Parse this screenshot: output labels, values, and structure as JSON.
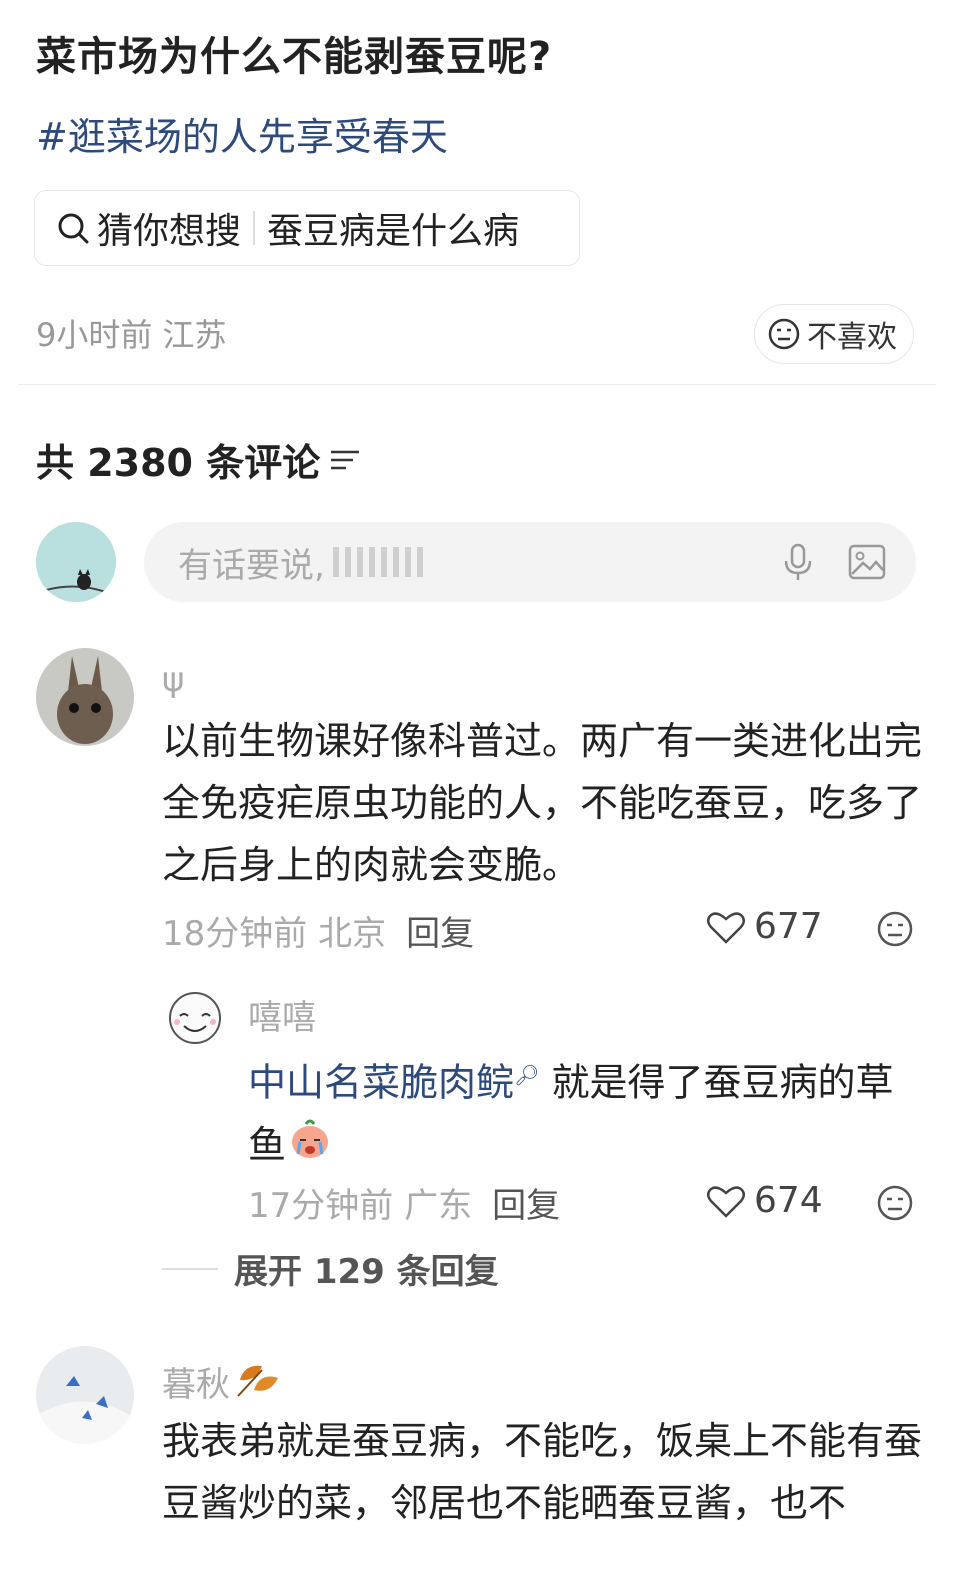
{
  "post": {
    "title": "菜市场为什么不能剥蚕豆呢?",
    "topic": "#逛菜场的人先享受春天",
    "search_suggest": {
      "lead": "猜你想搜",
      "query": "蚕豆病是什么病"
    },
    "time_location": "9小时前 江苏",
    "dislike_label": "不喜欢"
  },
  "comments_header": {
    "label": "共 2380 条评论"
  },
  "composer": {
    "placeholder": "有话要说,"
  },
  "comments": [
    {
      "user": "ψ",
      "text": "以前生物课好像科普过。两广有一类进化出完全免疫疟原虫功能的人，不能吃蚕豆，吃多了之后身上的肉就会变脆。",
      "meta": "18分钟前 北京",
      "reply_label": "回复",
      "likes": "677",
      "replies": [
        {
          "user": "嘻嘻",
          "mention": "中山名菜脆肉鲩",
          "text": " 就是得了蚕豆病的草鱼",
          "meta": "17分钟前 广东",
          "reply_label": "回复",
          "likes": "674"
        }
      ],
      "expand_label": "展开 129 条回复"
    },
    {
      "user": "暮秋",
      "text": "我表弟就是蚕豆病，不能吃，饭桌上不能有蚕豆酱炒的菜，邻居也不能晒蚕豆酱，也不"
    }
  ],
  "colors": {
    "link": "#2c4a7c",
    "muted": "#aaaaaa",
    "text": "#222222"
  }
}
